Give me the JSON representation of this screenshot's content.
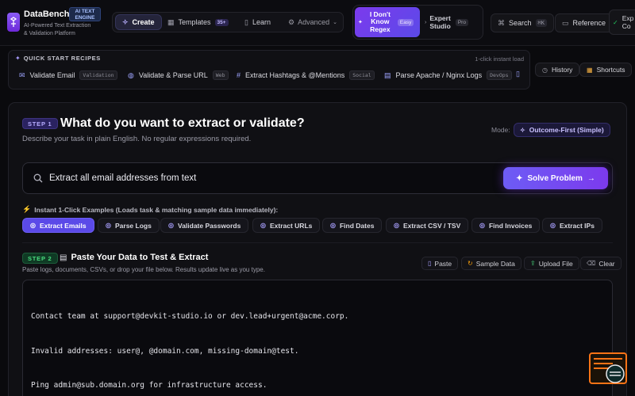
{
  "brand": {
    "name": "DataBench",
    "badge_line1": "AI TEXT",
    "badge_line2": "ENGINE",
    "tagline_line1": "AI-Powered Text Extraction",
    "tagline_line2": "& Validation Platform"
  },
  "nav": {
    "create": "Create",
    "templates": "Templates",
    "templates_count": "35+",
    "learn": "Learn",
    "advanced": "Advanced"
  },
  "mode_toggle": {
    "novice_line1": "I Don't",
    "novice_line2": "Know",
    "novice_line3": "Regex",
    "novice_badge": "Easy",
    "expert_line1": "Expert",
    "expert_line2": "Studio",
    "expert_badge": "Pro"
  },
  "top_actions": {
    "search": "Search",
    "search_kbd": "⌘K",
    "reference": "Reference",
    "export_line1": "Exp",
    "export_line2": "Co"
  },
  "quick_start": {
    "title": "QUICK START RECIPES",
    "hint": "1-click instant load",
    "recipes": [
      {
        "label": "Validate Email",
        "tag": "Validation"
      },
      {
        "label": "Validate & Parse URL",
        "tag": "Web"
      },
      {
        "label": "Extract Hashtags & @Mentions",
        "tag": "Social"
      },
      {
        "label": "Parse Apache / Nginx Logs",
        "tag": "DevOps"
      }
    ]
  },
  "side_buttons": {
    "history": "History",
    "shortcuts": "Shortcuts"
  },
  "step1": {
    "badge": "STEP 1",
    "title": "What do you want to extract or validate?",
    "subtitle": "Describe your task in plain English. No regular expressions required.",
    "mode_label": "Mode:",
    "mode_value": "Outcome-First (Simple)",
    "input_value": "Extract all email addresses from text",
    "solve_button": "Solve Problem",
    "examples_label": "Instant 1-Click Examples (Loads task & matching sample data immediately):",
    "examples": [
      "Extract Emails",
      "Parse Logs",
      "Validate Passwords",
      "Extract URLs",
      "Find Dates",
      "Extract CSV / TSV",
      "Find Invoices",
      "Extract IPs"
    ]
  },
  "step2": {
    "badge": "STEP 2",
    "title": "Paste Your Data to Test & Extract",
    "subtitle": "Paste logs, documents, CSVs, or drop your file below. Results update live as you type.",
    "tools": {
      "paste": "Paste",
      "sample": "Sample Data",
      "upload": "Upload File",
      "clear": "Clear"
    },
    "data_lines": [
      "Contact team at support@devkit-studio.io or dev.lead+urgent@acme.corp.",
      "Invalid addresses: user@, @domain.com, missing-domain@test.",
      "Ping admin@sub.domain.org for infrastructure access."
    ]
  },
  "colors": {
    "accent": "#5b4ae8",
    "accent_light": "#8b7bff",
    "background": "#0a0a0d",
    "panel": "#101014",
    "step1_badge": "#6d5cf5",
    "step2_badge": "#22c55e",
    "mascot": "#f97316"
  }
}
